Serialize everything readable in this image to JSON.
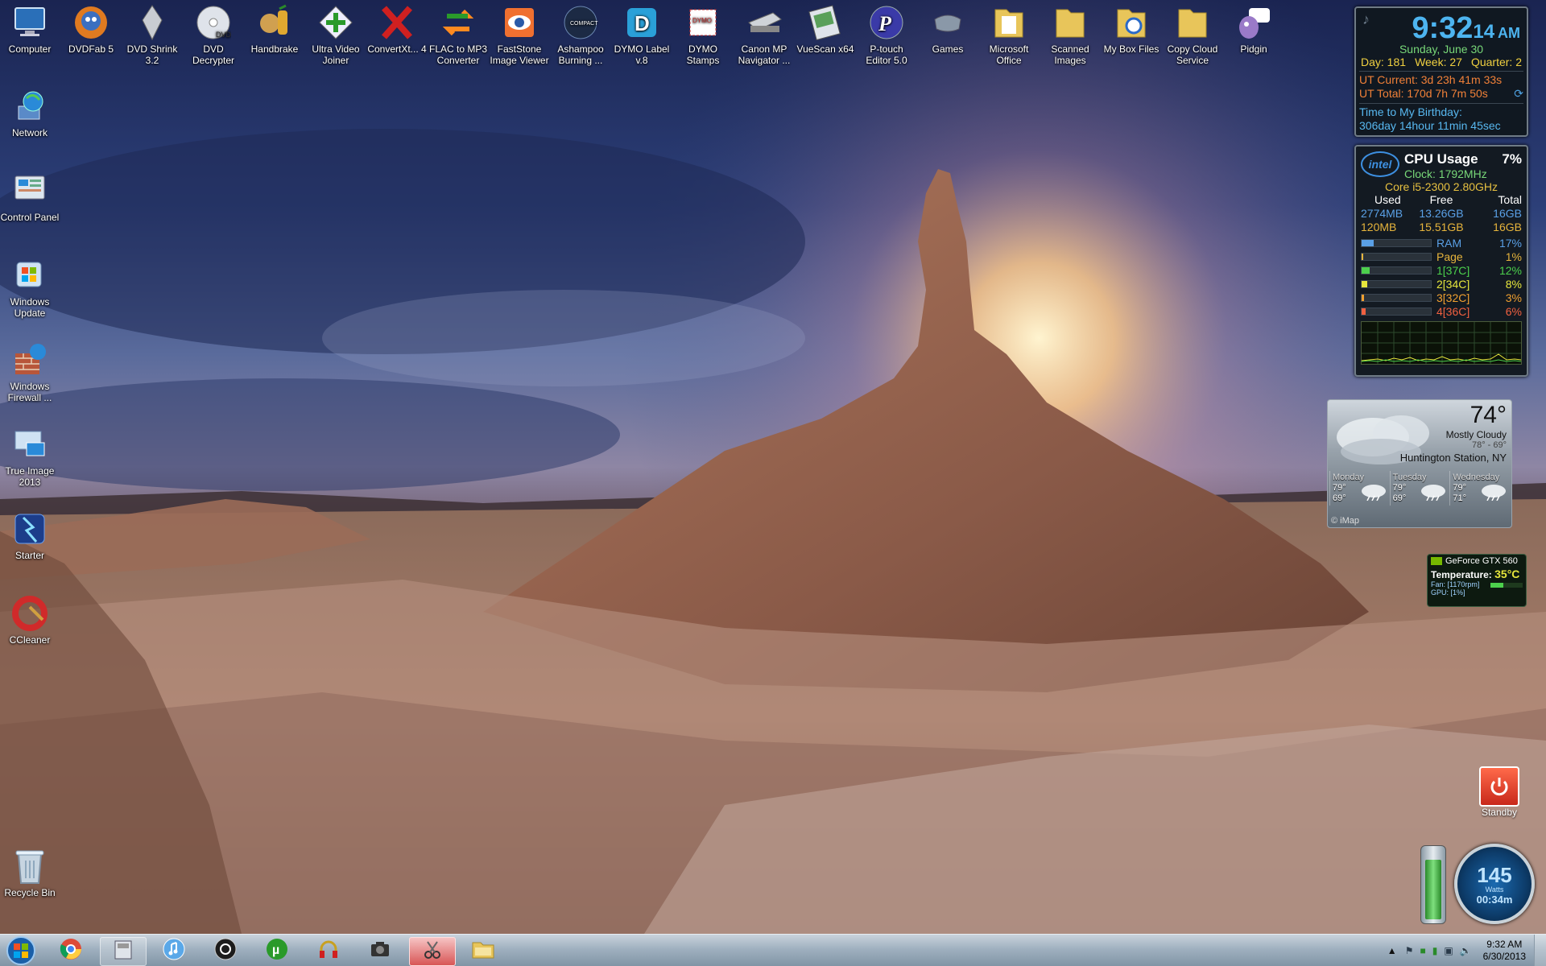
{
  "desktop": {
    "top_icons": [
      {
        "label": "Computer",
        "icon": "computer-icon"
      },
      {
        "label": "DVDFab 5",
        "icon": "dvdfab-icon"
      },
      {
        "label": "DVD Shrink 3.2",
        "icon": "dvdshrink-icon"
      },
      {
        "label": "DVD Decrypter",
        "icon": "dvd-decrypter-icon"
      },
      {
        "label": "Handbrake",
        "icon": "handbrake-icon"
      },
      {
        "label": "Ultra Video Joiner",
        "icon": "video-joiner-icon"
      },
      {
        "label": "ConvertXt... 4",
        "icon": "convertx-icon"
      },
      {
        "label": "FLAC to MP3 Converter",
        "icon": "flac-converter-icon"
      },
      {
        "label": "FastStone Image Viewer",
        "icon": "faststone-icon"
      },
      {
        "label": "Ashampoo Burning ...",
        "icon": "ashampoo-icon"
      },
      {
        "label": "DYMO Label v.8",
        "icon": "dymo-label-icon"
      },
      {
        "label": "DYMO Stamps",
        "icon": "dymo-stamps-icon"
      },
      {
        "label": "Canon MP Navigator ...",
        "icon": "canon-scanner-icon"
      },
      {
        "label": "VueScan x64",
        "icon": "vuescan-icon"
      },
      {
        "label": "P-touch Editor 5.0",
        "icon": "ptouch-icon"
      },
      {
        "label": "Games",
        "icon": "games-icon"
      },
      {
        "label": "Microsoft Office",
        "icon": "office-folder-icon"
      },
      {
        "label": "Scanned Images",
        "icon": "folder-icon"
      },
      {
        "label": "My Box Files",
        "icon": "box-folder-icon"
      },
      {
        "label": "Copy Cloud Service",
        "icon": "folder-icon"
      },
      {
        "label": "Pidgin",
        "icon": "pidgin-icon"
      }
    ],
    "left_icons": [
      {
        "label": "Network",
        "icon": "network-icon"
      },
      {
        "label": "Control Panel",
        "icon": "control-panel-icon"
      },
      {
        "label": "Windows Update",
        "icon": "windows-update-icon"
      },
      {
        "label": "Windows Firewall ...",
        "icon": "firewall-icon"
      },
      {
        "label": "True Image 2013",
        "icon": "true-image-icon"
      },
      {
        "label": "Starter",
        "icon": "starter-icon"
      },
      {
        "label": "CCleaner",
        "icon": "ccleaner-icon"
      }
    ],
    "recycle_bin": {
      "label": "Recycle Bin",
      "icon": "recycle-bin-icon"
    }
  },
  "clock_gadget": {
    "time": "9:32",
    "seconds": "14",
    "ampm": "AM",
    "date": "Sunday, June 30",
    "day": "Day: 181",
    "week": "Week: 27",
    "quarter": "Quarter: 2",
    "ut_current": "UT Current: 3d 23h 41m 33s",
    "ut_total": "UT Total: 170d 7h 7m 50s",
    "birthday_label": "Time to My Birthday:",
    "birthday_value": "306day 14hour 11min 45sec"
  },
  "cpu_gadget": {
    "brand": "intel",
    "title": "CPU Usage",
    "percent": "7%",
    "clock": "Clock: 1792MHz",
    "model": "Core i5-2300 2.80GHz",
    "headers": [
      "Used",
      "Free",
      "Total"
    ],
    "mem_rows": [
      {
        "used": "2774MB",
        "free": "13.26GB",
        "total": "16GB",
        "color": "#5aa0e6"
      },
      {
        "used": "120MB",
        "free": "15.51GB",
        "total": "16GB",
        "color": "#e6b43c"
      }
    ],
    "bars": [
      {
        "label": "RAM",
        "value": "17%",
        "fill": 0.17,
        "color": "#5aa0e6"
      },
      {
        "label": "Page",
        "value": "1%",
        "fill": 0.01,
        "color": "#e6b43c"
      },
      {
        "label": "1[37C]",
        "value": "12%",
        "fill": 0.12,
        "color": "#4cd04c"
      },
      {
        "label": "2[34C]",
        "value": "8%",
        "fill": 0.08,
        "color": "#e6e63c"
      },
      {
        "label": "3[32C]",
        "value": "3%",
        "fill": 0.03,
        "color": "#f0a030"
      },
      {
        "label": "4[36C]",
        "value": "6%",
        "fill": 0.06,
        "color": "#f06040"
      }
    ]
  },
  "weather_gadget": {
    "temp": "74°",
    "condition": "Mostly Cloudy",
    "hilo": "78° - 69°",
    "location": "Huntington Station, NY",
    "forecast": [
      {
        "day": "Monday",
        "hi": "79°",
        "lo": "69°"
      },
      {
        "day": "Tuesday",
        "hi": "79°",
        "lo": "69°"
      },
      {
        "day": "Wednesday",
        "hi": "79°",
        "lo": "71°"
      }
    ],
    "source": "© iMap"
  },
  "gpu_gadget": {
    "name": "GeForce GTX 560",
    "temp_label": "Temperature:",
    "temp_value": "35°C",
    "fan": "Fan: [1170rpm]",
    "gpu": "GPU: [1%]"
  },
  "standby_gadget": {
    "label": "Standby"
  },
  "battery_gadget": {
    "value": "145",
    "unit": "Watts",
    "time": "00:34m"
  },
  "taskbar": {
    "items": [
      {
        "name": "chrome-icon",
        "active": false
      },
      {
        "name": "explorer-window-icon",
        "active": false,
        "boxed": true
      },
      {
        "name": "itunes-icon",
        "active": false
      },
      {
        "name": "media-player-icon",
        "active": false
      },
      {
        "name": "utorrent-icon",
        "active": false
      },
      {
        "name": "headphones-icon",
        "active": false
      },
      {
        "name": "camera-icon",
        "active": false
      },
      {
        "name": "snipping-tool-icon",
        "active": true
      },
      {
        "name": "file-explorer-icon",
        "active": false
      }
    ],
    "clock_time": "9:32 AM",
    "clock_date": "6/30/2013"
  }
}
